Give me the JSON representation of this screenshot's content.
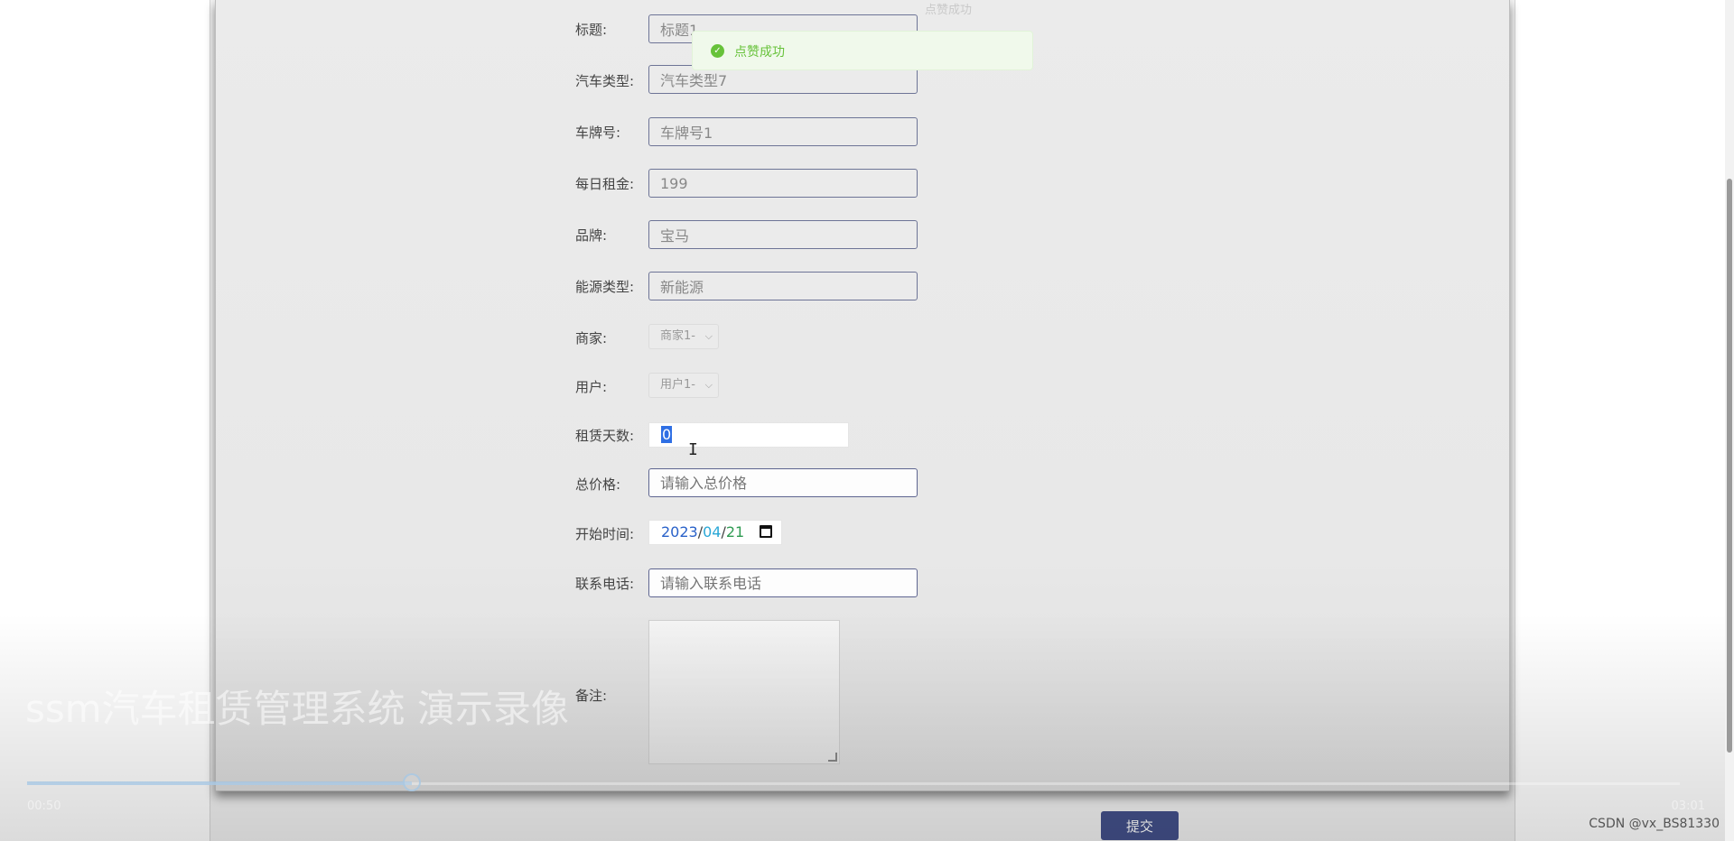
{
  "toast": {
    "message": "点赞成功",
    "ghost_text": "点赞成功"
  },
  "form": {
    "title": {
      "label": "标题:",
      "value": "标题1"
    },
    "car_type": {
      "label": "汽车类型:",
      "value": "汽车类型7"
    },
    "plate": {
      "label": "车牌号:",
      "value": "车牌号1"
    },
    "daily_rent": {
      "label": "每日租金:",
      "value": "199"
    },
    "brand": {
      "label": "品牌:",
      "value": "宝马"
    },
    "energy": {
      "label": "能源类型:",
      "value": "新能源"
    },
    "merchant": {
      "label": "商家:",
      "value": "商家1-"
    },
    "user": {
      "label": "用户:",
      "value": "用户1-"
    },
    "days": {
      "label": "租赁天数:",
      "value": "0"
    },
    "total_price": {
      "label": "总价格:",
      "placeholder": "请输入总价格"
    },
    "start_time": {
      "label": "开始时间:",
      "year": "2023",
      "month": "04",
      "day": "21",
      "sep": "/"
    },
    "phone": {
      "label": "联系电话:",
      "placeholder": "请输入联系电话"
    },
    "remark": {
      "label": "备注:"
    },
    "submit_label": "提交"
  },
  "video": {
    "title": "ssm汽车租赁管理系统 演示录像",
    "time_current": "00:50",
    "time_total": "03:01",
    "progress": 0.233
  },
  "watermark": "CSDN @vx_BS81330"
}
